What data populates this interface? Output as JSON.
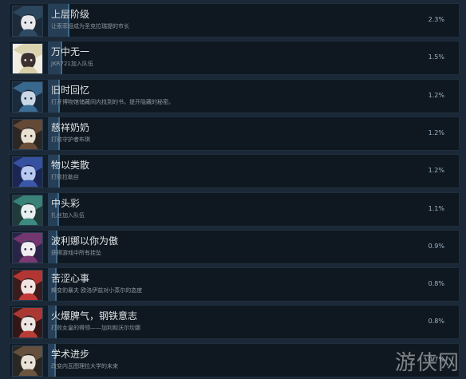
{
  "achievements": [
    {
      "title": "上层阶级",
      "desc": "让索菲娅成为圣克拉瑞提的市长",
      "pct_text": "2.3%",
      "pct": 2.3,
      "colors": [
        "#2d4a63",
        "#e8e8ea",
        "#1c2a3a"
      ]
    },
    {
      "title": "万中无一",
      "desc": "JKR721加入队伍",
      "pct_text": "1.5%",
      "pct": 1.5,
      "colors": [
        "#d8cfa8",
        "#3b3230",
        "#f2efe2"
      ]
    },
    {
      "title": "旧时回忆",
      "desc": "打开博物馆储藏间内找到的书，提开隐藏的秘密。",
      "pct_text": "1.2%",
      "pct": 1.2,
      "colors": [
        "#3c6f97",
        "#c9d7e6",
        "#1a2b3d"
      ]
    },
    {
      "title": "慈祥奶奶",
      "desc": "打败守护者布琪",
      "pct_text": "1.2%",
      "pct": 1.2,
      "colors": [
        "#6a4e3a",
        "#e9e1d2",
        "#2d2724"
      ]
    },
    {
      "title": "物以类散",
      "desc": "打败拉勒丝",
      "pct_text": "1.2%",
      "pct": 1.2,
      "colors": [
        "#3a57a8",
        "#b9c8ef",
        "#1c2655"
      ]
    },
    {
      "title": "中头彩",
      "desc": "扎丝加入队伍",
      "pct_text": "1.1%",
      "pct": 1.1,
      "colors": [
        "#3c8a80",
        "#e9eef0",
        "#1f3c3a"
      ]
    },
    {
      "title": "波利娜以你为傲",
      "desc": "获得游戏中所有挂坠",
      "pct_text": "0.9%",
      "pct": 0.9,
      "colors": [
        "#7b3a74",
        "#f0eef0",
        "#2a2447"
      ]
    },
    {
      "title": "苦涩心事",
      "desc": "蜂变豹暴夫 欧洛伊兹对小蒸尔的态度",
      "pct_text": "0.8%",
      "pct": 0.8,
      "colors": [
        "#c13a36",
        "#f2e6e2",
        "#3b1c1c"
      ]
    },
    {
      "title": "火爆脾气，钢铁意志",
      "desc": "打败女皇的得领——加利和沃尔坎娜",
      "pct_text": "0.8%",
      "pct": 0.8,
      "colors": [
        "#b83c36",
        "#ece6e2",
        "#341617"
      ]
    },
    {
      "title": "学术进步",
      "desc": "改变内瓦图理拉大学的未来",
      "pct_text": "0.7%",
      "pct": 0.7,
      "colors": [
        "#6b5540",
        "#e8e2d6",
        "#2a2622"
      ]
    }
  ],
  "watermark": "游侠网"
}
